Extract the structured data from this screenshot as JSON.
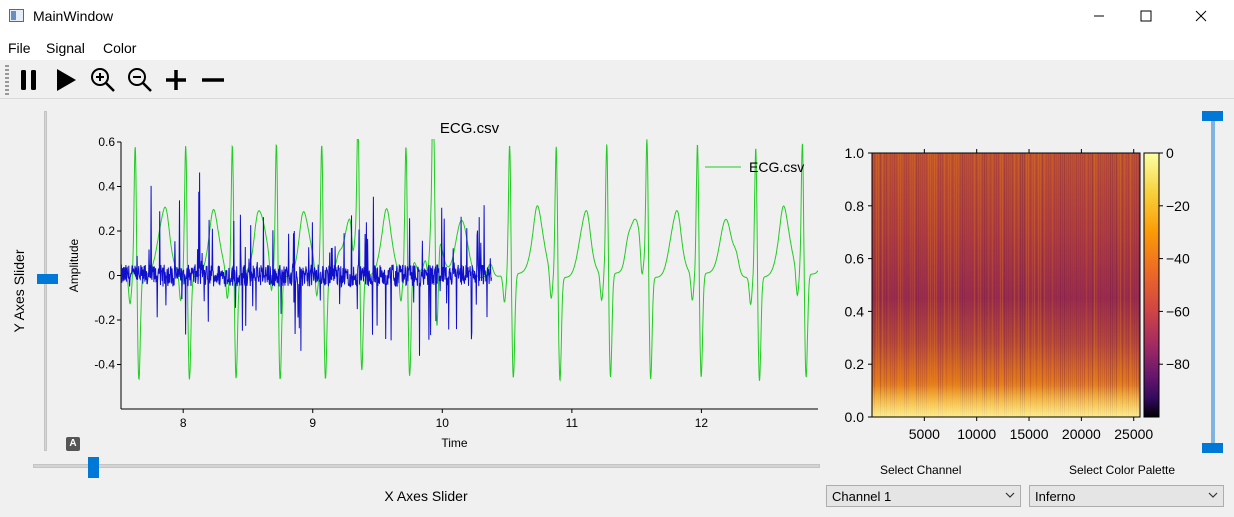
{
  "window": {
    "title": "MainWindow",
    "minimize_icon": "minimize-icon",
    "maximize_icon": "maximize-icon",
    "close_icon": "close-icon"
  },
  "menu": [
    "File",
    "Signal",
    "Color"
  ],
  "toolbar": {
    "icons": [
      "pause-icon",
      "play-icon",
      "zoom-in-icon",
      "zoom-out-icon",
      "plus-icon",
      "minus-icon"
    ]
  },
  "plot": {
    "badge": "A",
    "chart_data": {
      "type": "line",
      "title": "ECG.csv",
      "xlabel": "Time",
      "ylabel": "Amplitude",
      "xlim": [
        7.52,
        12.9
      ],
      "ylim": [
        -0.6,
        0.6
      ],
      "xticks": [
        8,
        9,
        10,
        11,
        12
      ],
      "yticks": [
        -0.4,
        -0.2,
        0,
        0.2,
        0.4,
        0.6
      ],
      "ytick_labels": [
        "-0.4",
        "-0.2",
        "0",
        "0.2",
        "0.4",
        "0.6"
      ],
      "legend": [
        {
          "name": "ECG.csv",
          "color": "#22cc22",
          "position": "top-right"
        }
      ],
      "series": [
        {
          "name": "ECG.csv",
          "color": "#22cc22",
          "style": "ecg",
          "r_peaks": [
            7.63,
            8.02,
            8.38,
            8.72,
            9.07,
            9.35,
            9.72,
            9.93,
            10.52,
            10.88,
            11.27,
            11.58,
            11.97,
            12.42,
            12.78
          ],
          "r_amplitude": 0.6,
          "s_amplitude": -0.47,
          "t_amplitude": 0.25,
          "x_range": [
            7.52,
            12.9
          ]
        },
        {
          "name": "",
          "color": "#1010cc",
          "style": "noise",
          "x_range": [
            7.52,
            10.38
          ],
          "noise_amplitude": 0.2
        }
      ]
    }
  },
  "spectrogram": {
    "chart_data": {
      "type": "heatmap",
      "xlim": [
        0,
        25600
      ],
      "ylim": [
        0,
        1
      ],
      "xticks": [
        5000,
        10000,
        15000,
        20000,
        25000
      ],
      "yticks": [
        0.0,
        0.2,
        0.4,
        0.6,
        0.8,
        1.0
      ],
      "ytick_labels": [
        "0.0",
        "0.2",
        "0.4",
        "0.6",
        "0.8",
        "1.0"
      ],
      "colorbar": {
        "range": [
          -100,
          0
        ],
        "ticks": [
          0,
          -20,
          -40,
          -60,
          -80
        ]
      },
      "colormap": "inferno"
    }
  },
  "sliders": {
    "y_axes_label": "Y Axes Slider",
    "x_axes_label": "X Axes Slider"
  },
  "controls": {
    "select_channel_label": "Select Channel",
    "channel_value": "Channel 1",
    "select_palette_label": "Select Color Palette",
    "palette_value": "Inferno"
  }
}
